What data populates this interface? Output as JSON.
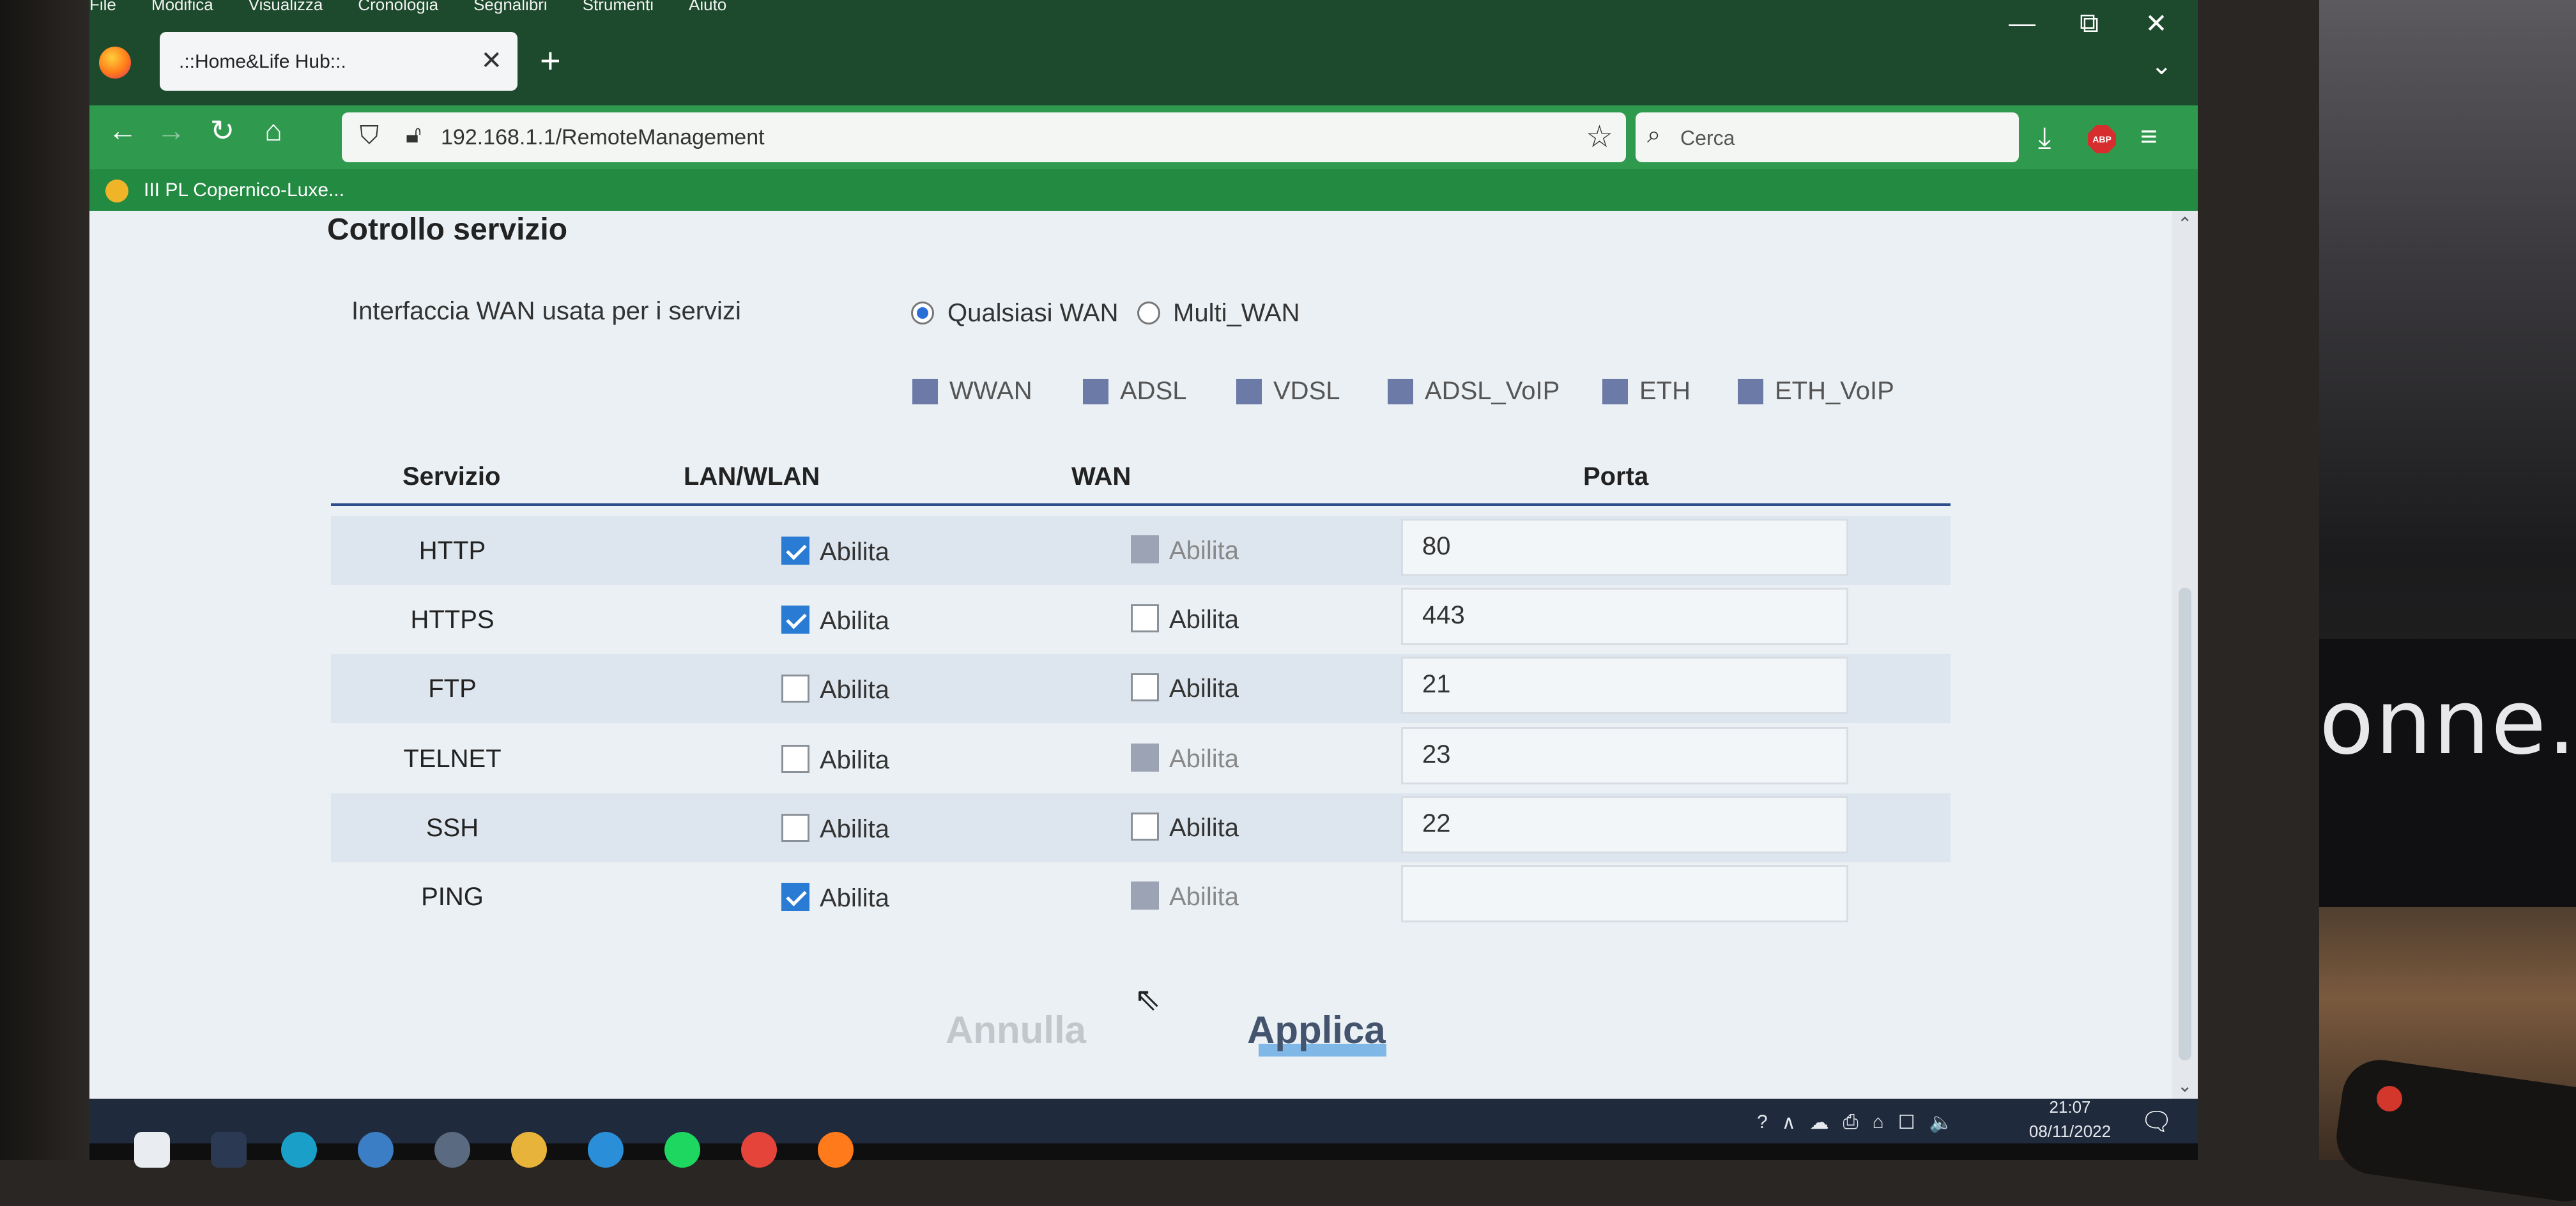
{
  "menu": [
    "File",
    "Modifica",
    "Visualizza",
    "Cronologia",
    "Segnalibri",
    "Strumenti",
    "Aiuto"
  ],
  "window_controls": {
    "minimize": "—",
    "restore": "⧉",
    "close": "✕"
  },
  "tab": {
    "title": ".::Home&Life Hub::.",
    "close": "✕",
    "new_tab": "+",
    "list_tabs": "⌄"
  },
  "nav": {
    "back": "←",
    "forward": "→",
    "reload": "↻",
    "home": "⌂"
  },
  "address": {
    "url": "192.168.1.1/RemoteManagement",
    "bookmark_star": "☆"
  },
  "search": {
    "placeholder": "Cerca",
    "icon": "⌕"
  },
  "toolbar": {
    "download": "⤓",
    "adblock": "ABP",
    "menu": "≡"
  },
  "bookmarks": [
    {
      "label": "III PL Copernico-Luxe..."
    }
  ],
  "page": {
    "section_title": "Cotrollo servizio",
    "wan_interface_label": "Interfaccia WAN usata per i servizi",
    "wan_radio": [
      {
        "label": "Qualsiasi WAN",
        "selected": true
      },
      {
        "label": "Multi_WAN",
        "selected": false
      }
    ],
    "wan_types": [
      "WWAN",
      "ADSL",
      "VDSL",
      "ADSL_VoIP",
      "ETH",
      "ETH_VoIP"
    ],
    "table": {
      "headers": {
        "service": "Servizio",
        "lan": "LAN/WLAN",
        "wan": "WAN",
        "port": "Porta"
      },
      "rows": [
        {
          "service": "HTTP",
          "lan_label": "Abilita",
          "lan_checked": true,
          "wan_label": "Abilita",
          "wan_state": "disabled",
          "port": "80"
        },
        {
          "service": "HTTPS",
          "lan_label": "Abilita",
          "lan_checked": true,
          "wan_label": "Abilita",
          "wan_state": "unchecked",
          "port": "443"
        },
        {
          "service": "FTP",
          "lan_label": "Abilita",
          "lan_checked": false,
          "wan_label": "Abilita",
          "wan_state": "unchecked",
          "port": "21"
        },
        {
          "service": "TELNET",
          "lan_label": "Abilita",
          "lan_checked": false,
          "wan_label": "Abilita",
          "wan_state": "disabled",
          "port": "23"
        },
        {
          "service": "SSH",
          "lan_label": "Abilita",
          "lan_checked": false,
          "wan_label": "Abilita",
          "wan_state": "unchecked",
          "port": "22"
        },
        {
          "service": "PING",
          "lan_label": "Abilita",
          "lan_checked": true,
          "wan_label": "Abilita",
          "wan_state": "disabled",
          "port": ""
        }
      ]
    },
    "buttons": {
      "cancel": "Annulla",
      "apply": "Applica"
    }
  },
  "taskbar": {
    "clock_time": "21:07",
    "clock_date": "08/11/2022",
    "tray_icons": [
      "?",
      "∧",
      "☁",
      "⎙",
      "⌂",
      "☐",
      "🔈"
    ]
  },
  "background": {
    "tv_text": "onne..."
  },
  "colors": {
    "titlebar": "#1d4a2c",
    "navbar": "#2f9a4e",
    "accent_check": "#2a7bd4",
    "table_rule": "#2e4d8c"
  }
}
